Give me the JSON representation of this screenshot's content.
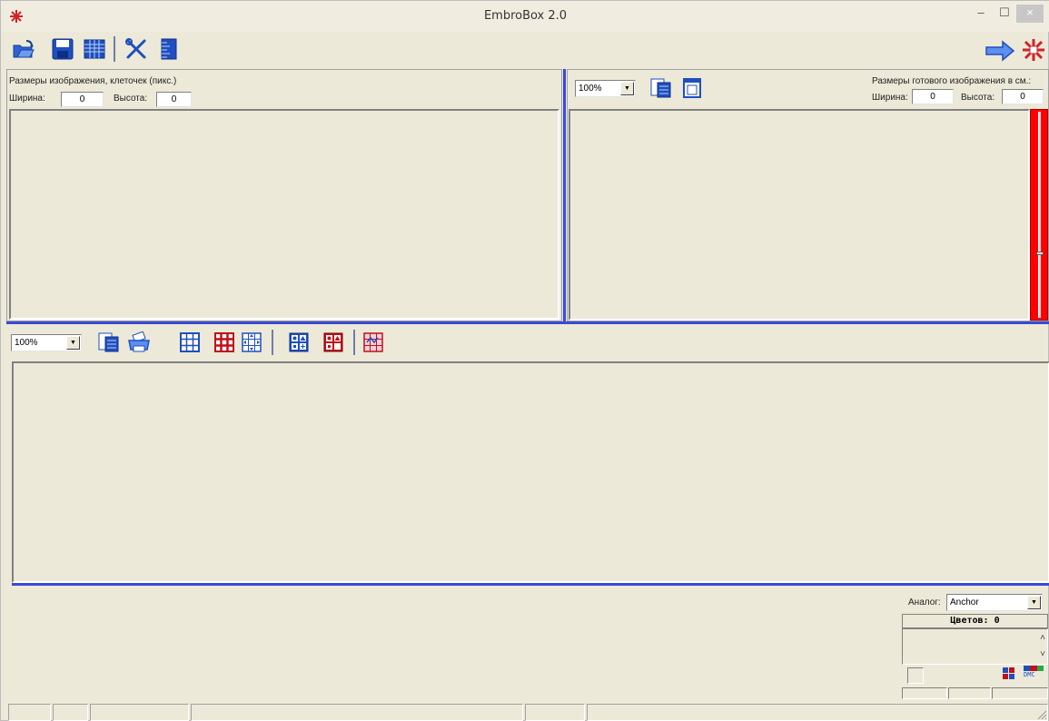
{
  "window": {
    "title": "EmbroBox 2.0",
    "min_glyph": "–",
    "max_glyph": "☐",
    "close_glyph": "×"
  },
  "toolbar_main": {
    "icons": [
      "open-folder-icon",
      "save-icon",
      "table-icon",
      "tools-icon",
      "ruler-icon"
    ],
    "right_icons": [
      "arrow-right-icon",
      "app-snowflake-icon"
    ]
  },
  "left_panel": {
    "header": "Размеры изображения, клеточек (пикс.)",
    "width_label": "Ширина:",
    "width_value": "0",
    "height_label": "Высота:",
    "height_value": "0"
  },
  "right_panel": {
    "zoom": "100%",
    "header": "Размеры готового изображения в см.:",
    "width_label": "Ширина:",
    "width_value": "0",
    "height_label": "Высота:",
    "height_value": "0",
    "accent_color": "#ff0000"
  },
  "pattern_toolbar": {
    "zoom": "100%"
  },
  "bottom_right": {
    "analog_label": "Аналог:",
    "analog_value": "Anchor",
    "colors_label": "Цветов: 0",
    "scroll_up": "˄",
    "scroll_down": "˅",
    "dmc_label": "DMC"
  },
  "colors": {
    "splitter": "#3a49d8",
    "face": "#ece9d8",
    "icon_blue": "#1f4fbf",
    "icon_red": "#c0101a"
  }
}
